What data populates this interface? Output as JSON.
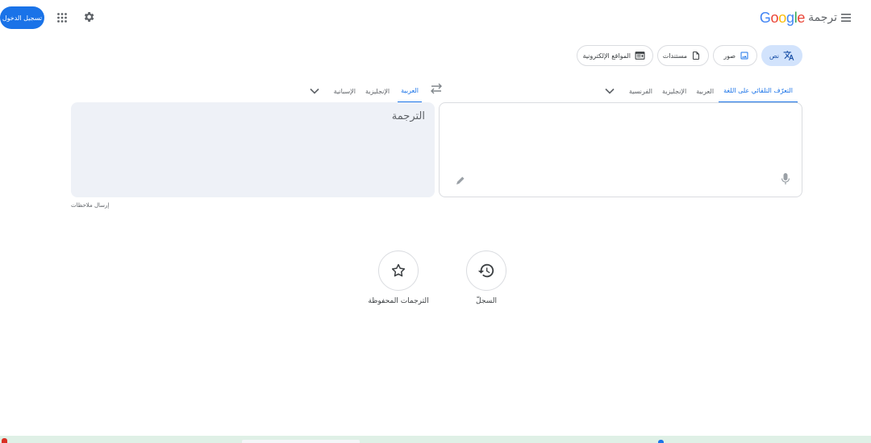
{
  "header": {
    "brand_logo": "Google",
    "brand_title": "ترجمة",
    "signin_label": "تسجيل الدخول",
    "icons": [
      "menu-icon",
      "apps-icon",
      "settings-icon"
    ]
  },
  "modes": {
    "text": "نص",
    "images": "صور",
    "documents": "مستندات",
    "websites": "المواقع الإلكترونية"
  },
  "source_langs": {
    "detect": "التعرّف التلقائي على اللغة",
    "arabic": "العربية",
    "english": "الإنجليزية",
    "french": "الفرنسية"
  },
  "target_langs": {
    "arabic": "العربية",
    "english": "الإنجليزية",
    "spanish": "الإسبانية"
  },
  "source_input": {
    "value": "",
    "placeholder": ""
  },
  "target_placeholder": "الترجمة",
  "feedback_label": "إرسال ملاحظات",
  "bottom": {
    "history_label": "السجلّ",
    "saved_label": "الترجمات المحفوظة"
  },
  "colors": {
    "accent": "#1a73e8",
    "active_chip_bg": "#d2e3fc",
    "target_panel_bg": "#eef1f7",
    "taskbar": "#dff0e6"
  }
}
